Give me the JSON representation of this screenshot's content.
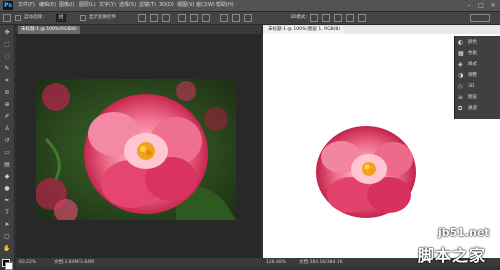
{
  "app": {
    "logo": "Ps"
  },
  "menu": [
    "文件(F)",
    "编辑(E)",
    "图像(I)",
    "图层(L)",
    "文字(Y)",
    "选择(S)",
    "滤镜(T)",
    "3D(D)",
    "视图(V)",
    "窗口(W)",
    "帮助(H)"
  ],
  "window_controls": [
    "–",
    "□",
    "✕"
  ],
  "options": {
    "tolerance_label": "自动选择：",
    "tolerance_value": "组",
    "show_transform": "显示变换控件",
    "mode_label": "3D模式："
  },
  "tabs": {
    "left": "未标题-1 @ 100%(RGB/8)",
    "right": "未标题-1 @ 100%(图层 1, RGB/8)"
  },
  "status": {
    "left_zoom": "60.22%",
    "left_doc": "文档:3.84M/3.84M",
    "right_zoom": "126.48%",
    "right_doc": "文档:384.1K/384.1K"
  },
  "panel": {
    "items": [
      "颜色",
      "色板",
      "样式",
      "调整",
      "3D",
      "图层",
      "通道"
    ]
  },
  "watermark": {
    "site": "jb51.net",
    "brand": "脚本之家"
  },
  "colors": {
    "accent": "#4fb4ff",
    "flower": "#e0426d",
    "center": "#f2a21b"
  }
}
